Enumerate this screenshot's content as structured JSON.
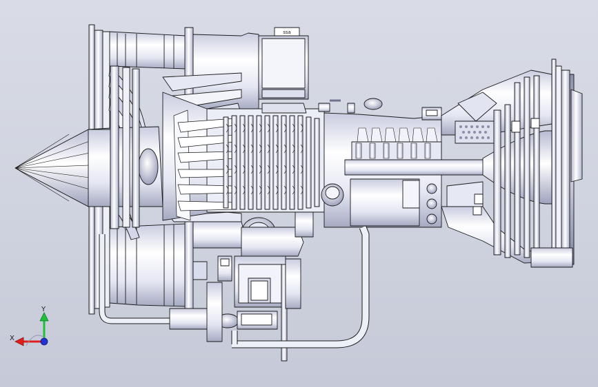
{
  "viewport": {
    "background_top": "#d9dce6",
    "background_bottom": "#c6cad8"
  },
  "model": {
    "part_label": "ssa",
    "line_color": "#1a1a1a",
    "metal_light": "#ffffff",
    "metal_dark": "#a9adc4",
    "highlight": "#e8e9f6"
  },
  "triad": {
    "x_label": "X",
    "y_label": "Y",
    "x_color": "#e0201c",
    "y_color": "#1fbf3a",
    "z_color": "#2233d0"
  }
}
